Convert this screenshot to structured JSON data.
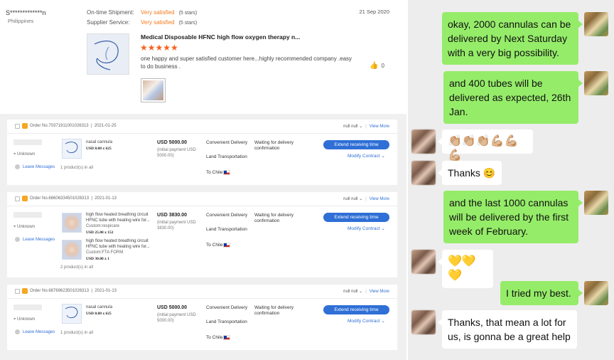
{
  "review": {
    "user": "S*************n",
    "country": "Philippines",
    "shipment_label": "On-time Shipment:",
    "shipment_value": "Very satisfied",
    "shipment_stars": "(5 stars)",
    "service_label": "Supplier Service:",
    "service_value": "Very satisfied",
    "service_stars": "(5 stars)",
    "date": "21 Sep 2020",
    "product_title": "Medical Disposable HFNC high flow oxygen therapy n...",
    "rating_stars": "★★★★★",
    "text": "one happy  and super  satisfied customer  here...highly  recommended  company .easy to do business .",
    "likes": "0"
  },
  "orders": [
    {
      "order_no": "Order No.70371911001026313",
      "date": "2021-01-25",
      "null_label": "null null",
      "view_more": "View More",
      "location": "Unknown",
      "leave_messages": "Leave Messages",
      "products": [
        {
          "name": "nasal cannula",
          "price": "USD 8.00 x 625",
          "custom": ""
        }
      ],
      "count": "1 product(s) in all",
      "total": "USD 5000.00",
      "initial": "(initial payment USD 5000.00)",
      "ship_type": "Convenient Delivery",
      "transport": "Land Transportation",
      "destination": "To Chile",
      "status": "Waiting for delivery confirmation",
      "extend": "Extend receiving time",
      "modify": "Modify Contract"
    },
    {
      "order_no": "Order No.68606334501026313",
      "date": "2021-01-13",
      "null_label": "null null",
      "view_more": "View More",
      "location": "Unknown",
      "leave_messages": "Leave Messages",
      "products": [
        {
          "name": "high flow heated breathing circuit HFNC tube with heating wire for...",
          "price": "USD 25.00 x 152",
          "custom": "Custom:respicare"
        },
        {
          "name": "high flow heated breathing circuit HFNC tube with heating wire for...",
          "price": "USD 30.00 x 1",
          "custom": "Custom:FTA FORM"
        }
      ],
      "count": "2 product(s) in all",
      "total": "USD 3830.00",
      "initial": "(initial payment USD 3830.00)",
      "ship_type": "Convenient Delivery",
      "transport": "Land Transportation",
      "destination": "To Chile",
      "status": "Waiting for delivery confirmation",
      "extend": "Extend receiving time",
      "modify": "Modify Contract"
    },
    {
      "order_no": "Order No.68769623501026313",
      "date": "2021-01-13",
      "null_label": "null null",
      "view_more": "View More",
      "location": "Unknown",
      "leave_messages": "Leave Messages",
      "products": [
        {
          "name": "nasal cannula",
          "price": "USD 8.00 x 625",
          "custom": ""
        }
      ],
      "count": "1 product(s) in all",
      "total": "USD 5000.00",
      "initial": "(initial payment USD 5000.00)",
      "ship_type": "Convenient Delivery",
      "transport": "Land Transportation",
      "destination": "To Chile",
      "status": "Waiting for delivery confirmation",
      "extend": "Extend receiving time",
      "modify": "Modify Contract"
    }
  ],
  "chat": {
    "messages": [
      {
        "from": "me",
        "text": "okay, 2000 cannulas can be delivered by Next Saturday with a very big possibility."
      },
      {
        "from": "me",
        "text": "and 400 tubes will be delivered as expected, 26th Jan."
      },
      {
        "from": "them",
        "text": "👏🏼👏🏼👏🏼💪🏼💪🏼💪🏼"
      },
      {
        "from": "them",
        "text": "Thanks 😊"
      },
      {
        "from": "me",
        "text": "and the last 1000 cannulas will be delivered by the first week of February."
      },
      {
        "from": "them",
        "text": "💛💛💛"
      },
      {
        "from": "me",
        "text": "I tried my best."
      },
      {
        "from": "them",
        "text": "Thanks, that mean a lot for us, is gonna be a great help"
      }
    ]
  },
  "colors": {
    "accent_orange": "#f47a1f",
    "link_blue": "#2f6fd6",
    "chat_me": "#95ec69",
    "chat_bg": "#ededed"
  }
}
